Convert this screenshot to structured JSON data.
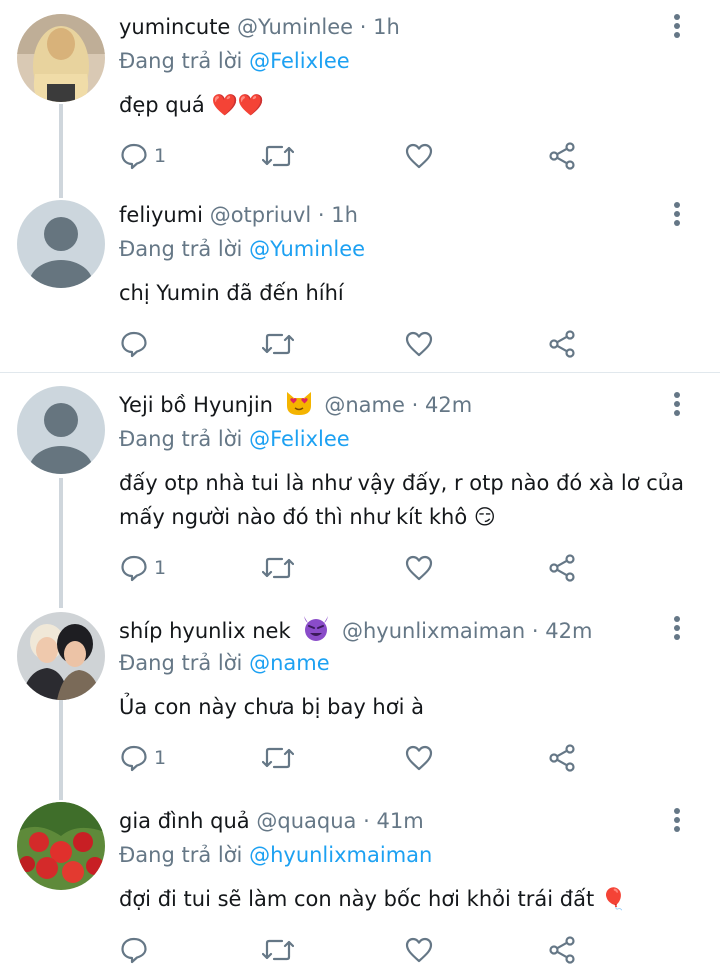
{
  "tweets": [
    {
      "name": "yumincute",
      "handle": "@Yuminlee",
      "time": "1h",
      "reply_prefix": "Đang trả lời",
      "reply_to": "@Felixlee",
      "text": "đẹp quá ❤️❤️",
      "reply_count": "1"
    },
    {
      "name": "feliyumi",
      "handle": "@otpriuvl",
      "time": "1h",
      "reply_prefix": "Đang trả lời",
      "reply_to": "@Yuminlee",
      "text": "chị Yumin đã đến híhí",
      "reply_count": ""
    },
    {
      "name": "Yeji bồ Hyunjin",
      "handle": "@name",
      "time": "42m",
      "reply_prefix": "Đang trả lời",
      "reply_to": "@Felixlee",
      "text": "đấy otp nhà tui là như vậy đấy, r otp nào đó xà lơ của mấy người nào đó thì như kít khô 😏",
      "reply_count": "1"
    },
    {
      "name": "shíp hyunlix nek",
      "handle": "@hyunlixmaiman",
      "time": "42m",
      "reply_prefix": "Đang trả lời",
      "reply_to": "@name",
      "text": "Ủa con này chưa bị bay hơi à",
      "reply_count": "1"
    },
    {
      "name": "gia đình quả",
      "handle": "@quaqua",
      "time": "41m",
      "reply_prefix": "Đang trả lời",
      "reply_to": "@hyunlixmaiman",
      "text": "đợi đi tui sẽ làm con này bốc hơi khỏi trái đất 🎈",
      "reply_count": ""
    }
  ],
  "separator": "·",
  "icons": {
    "reply": "reply-icon",
    "retweet": "retweet-icon",
    "like": "heart-icon",
    "share": "share-icon",
    "more": "more-vertical-icon"
  },
  "colors": {
    "mention": "#1da1f2",
    "secondary_text": "#657786",
    "divider": "#e1e8ed",
    "thread_line": "#cfd6dc"
  }
}
